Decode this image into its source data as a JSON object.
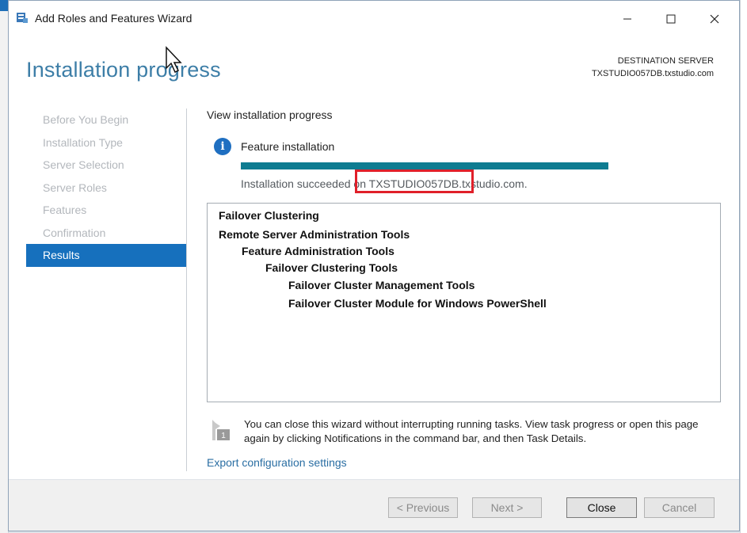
{
  "window": {
    "title": "Add Roles and Features Wizard",
    "controls": {
      "minimize": "—",
      "maximize": "☐",
      "close": "✕"
    }
  },
  "header": {
    "title": "Installation progress",
    "destination_label": "DESTINATION SERVER",
    "destination_server": "TXSTUDIO057DB.txstudio.com"
  },
  "nav": {
    "items": [
      {
        "label": "Before You Begin"
      },
      {
        "label": "Installation Type"
      },
      {
        "label": "Server Selection"
      },
      {
        "label": "Server Roles"
      },
      {
        "label": "Features"
      },
      {
        "label": "Confirmation"
      },
      {
        "label": "Results"
      }
    ],
    "active": "Results"
  },
  "main": {
    "view_label": "View installation progress",
    "feature_label": "Feature installation",
    "progress": 1.0,
    "status_text": "Installation succeeded on TXSTUDIO057DB.txstudio.com.",
    "results": [
      {
        "label": "Failover Clustering",
        "level": 0
      },
      {
        "label": "Remote Server Administration Tools",
        "level": 0
      },
      {
        "label": "Feature Administration Tools",
        "level": 1
      },
      {
        "label": "Failover Clustering Tools",
        "level": 2
      },
      {
        "label": "Failover Cluster Management Tools",
        "level": 3
      },
      {
        "label": "Failover Cluster Module for Windows PowerShell",
        "level": 3
      }
    ],
    "note_text": "You can close this wizard without interrupting running tasks. View task progress or open this page again by clicking Notifications in the command bar, and then Task Details.",
    "note_badge": "1",
    "export_link": "Export configuration settings"
  },
  "footer": {
    "previous": "< Previous",
    "next": "Next >",
    "close": "Close",
    "cancel": "Cancel"
  },
  "colors": {
    "heading": "#3d7ea7",
    "nav_active": "#1670bd",
    "progress_fill": "#0e7c91",
    "highlight": "#e0202a",
    "link": "#2a6ea3"
  },
  "icons": {
    "app": "server-manager-icon",
    "info": "info-icon",
    "note": "flag-icon",
    "cursor": "mouse-pointer-icon"
  }
}
